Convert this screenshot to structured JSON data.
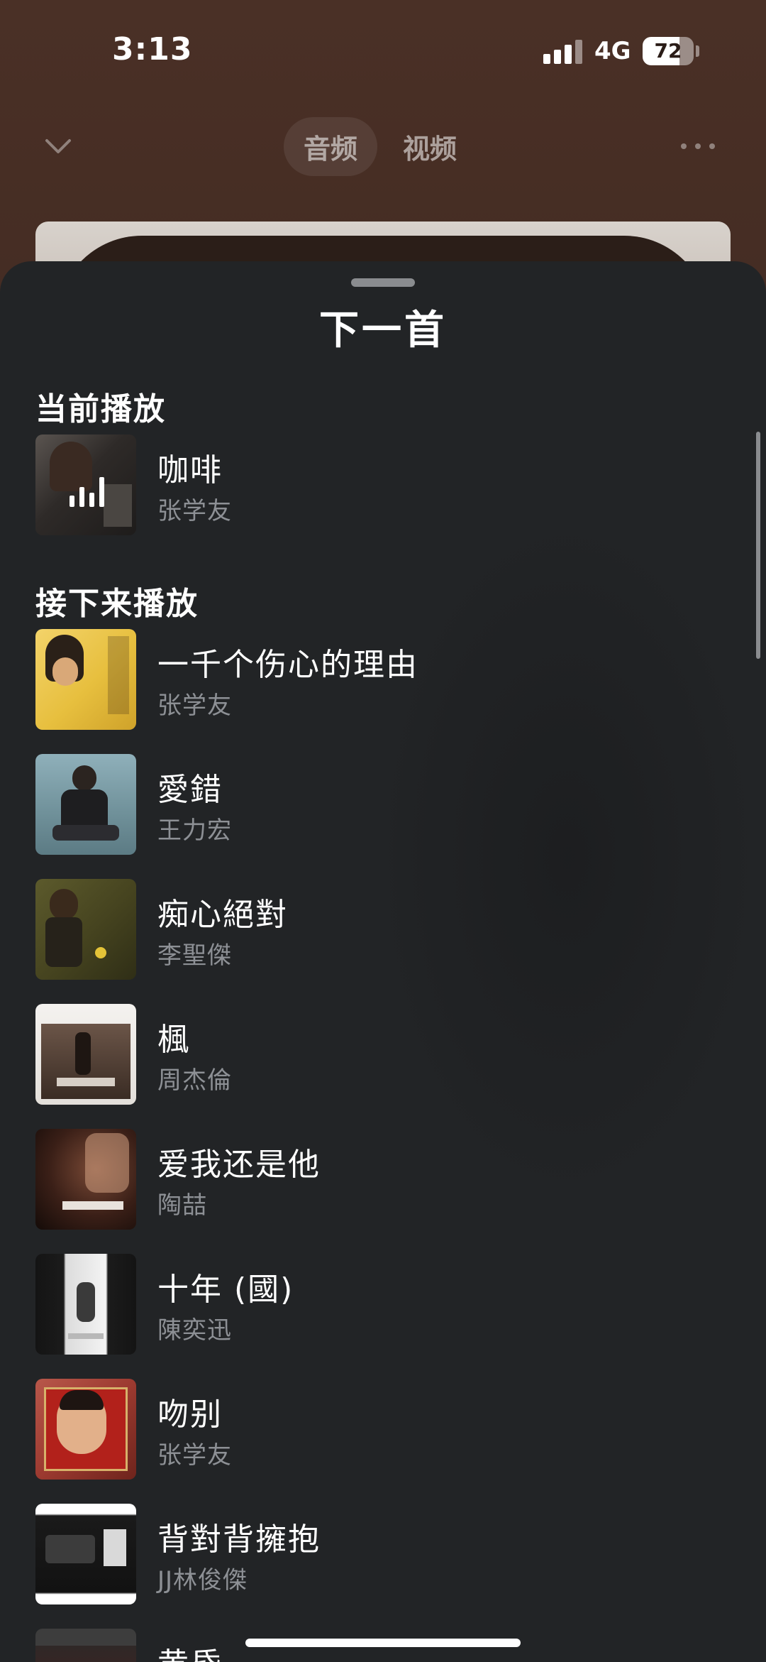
{
  "status_bar": {
    "time": "3:13",
    "network": "4G",
    "battery": "72",
    "battery_level_percent": 72,
    "signal_bars_active": 3,
    "signal_bars_total": 4
  },
  "player": {
    "collapse_icon": "chevron-down-icon",
    "tabs": [
      {
        "label": "音频",
        "active": true
      },
      {
        "label": "视频",
        "active": false
      }
    ],
    "more_icon": "more-icon"
  },
  "sheet": {
    "title": "下一首",
    "now_playing_label": "当前播放",
    "now_playing": {
      "title": "咖啡",
      "artist": "张学友",
      "indicator_icon": "equalizer-icon"
    },
    "up_next_label": "接下来播放",
    "queue": [
      {
        "title": "一千个伤心的理由",
        "artist": "张学友"
      },
      {
        "title": "愛錯",
        "artist": "王力宏"
      },
      {
        "title": "痴心絕對",
        "artist": "李聖傑"
      },
      {
        "title": "楓",
        "artist": "周杰倫"
      },
      {
        "title": "爱我还是他",
        "artist": "陶喆"
      },
      {
        "title": "十年 (國)",
        "artist": "陳奕迅"
      },
      {
        "title": "吻别",
        "artist": "张学友"
      },
      {
        "title": "背對背擁抱",
        "artist": "JJ林俊傑"
      },
      {
        "title": "黄昏",
        "artist": ""
      }
    ]
  },
  "colors": {
    "sheet_background": "#222426",
    "primary_text": "#ffffff",
    "secondary_text": "#8d9095",
    "player_background": "#4a3026"
  }
}
